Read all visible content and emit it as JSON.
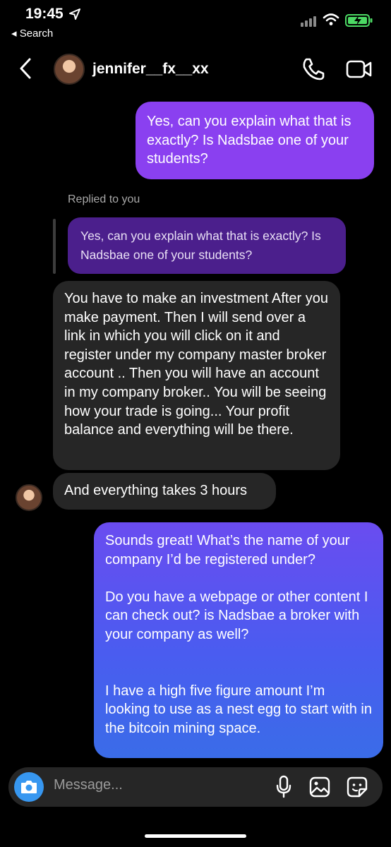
{
  "status_bar": {
    "time": "19:45",
    "back_app": "◂ Search"
  },
  "header": {
    "username": "jennifer__fx__xx"
  },
  "messages": {
    "sent_1": "Yes, can you explain what that is exactly? Is Nadsbae one of your students?",
    "replied_label": "Replied to you",
    "reply_quote": "Yes, can you explain what that is exactly? Is Nadsbae one of your students?",
    "received_1": "You have to make an investment After you make payment. Then I will send over a link in which you will click on it and register under my company master broker account .. Then you will have an account in my company broker.. You will be seeing how your trade is going... Your profit balance and everything will be there.",
    "received_2": "And everything takes 3 hours",
    "sent_2": {
      "p1": "Sounds great! What’s the name of your company I’d be registered under?",
      "p2": "Do you have a webpage or other content I can check out? is Nadsbae a broker with your company as well?",
      "p3": "I have a high five figure amount I’m looking to use as a nest egg to start with in the bitcoin mining space."
    }
  },
  "composer": {
    "placeholder": "Message..."
  },
  "colors": {
    "sent_bubble_top": "#8a40f0",
    "sent_bubble_gradient": "#4a5cf0",
    "received_bubble": "#262626",
    "accent_blue": "#3797f0"
  },
  "icons": [
    "location-arrow-icon",
    "cellular-signal-icon",
    "wifi-icon",
    "battery-charging-icon",
    "back-chevron-icon",
    "phone-icon",
    "video-camera-icon",
    "camera-icon",
    "microphone-icon",
    "gallery-icon",
    "sticker-icon"
  ]
}
